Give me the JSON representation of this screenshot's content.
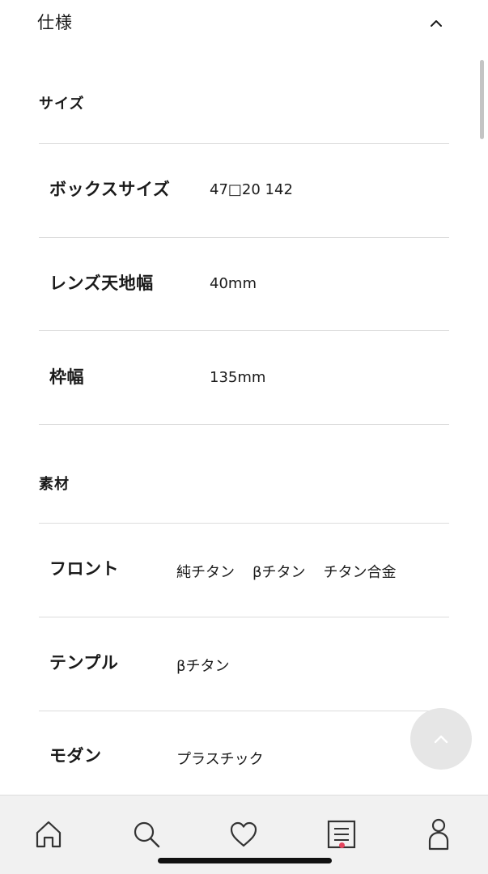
{
  "accordion": {
    "title": "仕様",
    "expanded": true,
    "icon": "chevron-up-icon"
  },
  "sections": {
    "size": {
      "title": "サイズ",
      "rows": [
        {
          "label": "ボックスサイズ",
          "value": "47□20 142"
        },
        {
          "label": "レンズ天地幅",
          "value": "40mm"
        },
        {
          "label": "枠幅",
          "value": "135mm"
        }
      ]
    },
    "material": {
      "title": "素材",
      "rows": [
        {
          "label": "フロント",
          "values": [
            "純チタン",
            "βチタン",
            "チタン合金"
          ]
        },
        {
          "label": "テンプル",
          "values": [
            "βチタン"
          ]
        },
        {
          "label": "モダン",
          "values": [
            "プラスチック"
          ]
        }
      ]
    }
  },
  "back_to_top": {
    "icon": "chevron-up-icon"
  },
  "bottom_nav": {
    "items": [
      {
        "name": "home",
        "icon": "home-icon"
      },
      {
        "name": "search",
        "icon": "search-icon"
      },
      {
        "name": "favorites",
        "icon": "heart-icon"
      },
      {
        "name": "list",
        "icon": "list-icon",
        "has_badge": true
      },
      {
        "name": "account",
        "icon": "person-icon"
      }
    ],
    "badge_color": "#e3455e"
  }
}
